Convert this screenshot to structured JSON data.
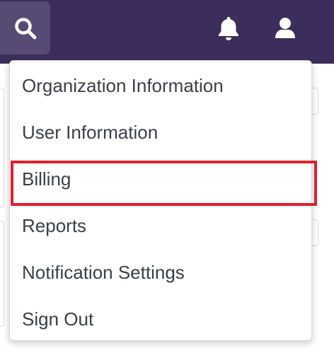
{
  "header": {
    "search_icon": "search-icon",
    "bell_icon": "bell-icon",
    "user_icon": "user-icon"
  },
  "menu": {
    "items": [
      {
        "label": "Organization Information",
        "highlighted": false
      },
      {
        "label": "User Information",
        "highlighted": false
      },
      {
        "label": "Billing",
        "highlighted": true
      },
      {
        "label": "Reports",
        "highlighted": false
      },
      {
        "label": "Notification Settings",
        "highlighted": false
      },
      {
        "label": "Sign Out",
        "highlighted": false
      }
    ]
  },
  "colors": {
    "header_bg": "#3d2d5c",
    "search_bg": "#574a75",
    "highlight": "#e0202e",
    "text": "#3a3f4a"
  }
}
